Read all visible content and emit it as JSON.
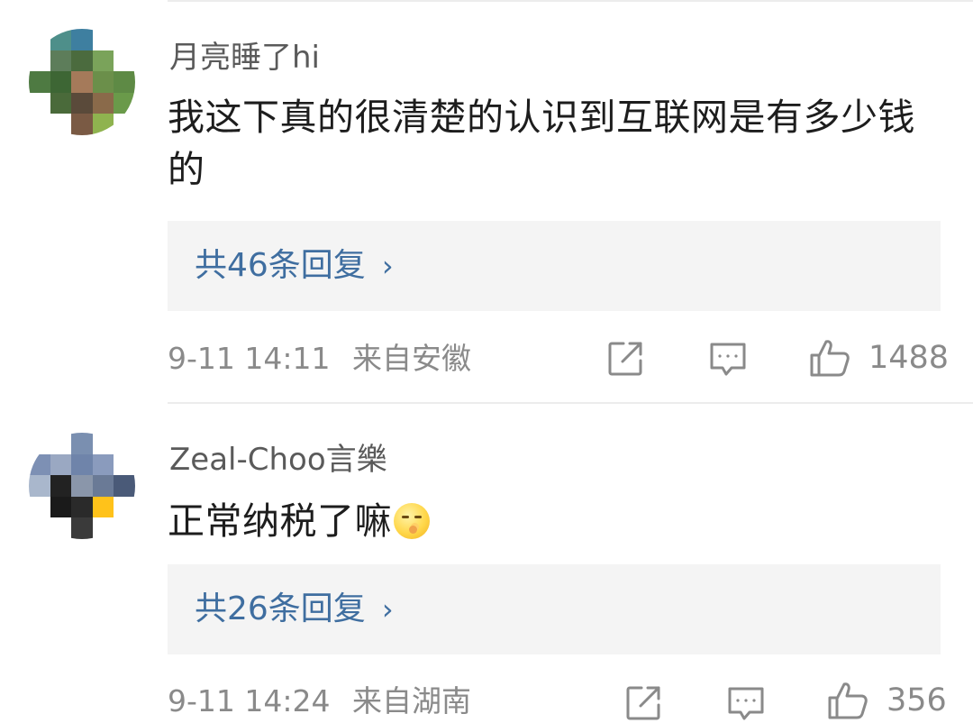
{
  "comments": [
    {
      "username": "月亮睡了hi",
      "content": "我这下真的很清楚的认识到互联网是有多少钱的",
      "emoji": "",
      "replies_label": "共46条回复",
      "replies_chevron": "›",
      "timestamp": "9-11 14:11",
      "location": "来自安徽",
      "like_count": "1488",
      "avatar_colors": [
        [
          "#ffffff",
          "#4e8f8a",
          "#3e7fa0",
          "#ffffff",
          "#ffffff"
        ],
        [
          "#ffffff",
          "#5d7d5a",
          "#4b6b3e",
          "#7aa35a",
          "#ffffff"
        ],
        [
          "#4e7a42",
          "#3d6634",
          "#a57a5a",
          "#6b8f4a",
          "#5e8a45"
        ],
        [
          "#ffffff",
          "#4a6a3a",
          "#5a4a3a",
          "#8a6a4a",
          "#6a9a4a"
        ],
        [
          "#ffffff",
          "#ffffff",
          "#7a5a44",
          "#8fb34f",
          "#ffffff"
        ]
      ]
    },
    {
      "username": "Zeal-Choo言樂",
      "content": "正常纳税了嘛",
      "emoji": "shush-face-emoji",
      "replies_label": "共26条回复",
      "replies_chevron": "›",
      "timestamp": "9-11 14:24",
      "location": "来自湖南",
      "like_count": "356",
      "avatar_colors": [
        [
          "#ffffff",
          "#ffffff",
          "#7a8fb0",
          "#ffffff",
          "#ffffff"
        ],
        [
          "#7d90b4",
          "#9aa8c2",
          "#6f84aa",
          "#8a9bbd",
          "#ffffff"
        ],
        [
          "#a9b7cc",
          "#222222",
          "#8a96aa",
          "#6a7a96",
          "#4a5a78"
        ],
        [
          "#ffffff",
          "#1a1a1a",
          "#2a2a2a",
          "#ffc21a",
          "#ffffff"
        ],
        [
          "#ffffff",
          "#ffffff",
          "#3a3a3a",
          "#ffffff",
          "#ffffff"
        ]
      ]
    }
  ],
  "icons": {
    "share": "share-icon",
    "comment": "comment-icon",
    "like": "thumbs-up-icon"
  },
  "colors": {
    "link": "#3f6ea0",
    "meta": "#8a8a8a",
    "reply_box_bg": "#f4f4f4"
  }
}
